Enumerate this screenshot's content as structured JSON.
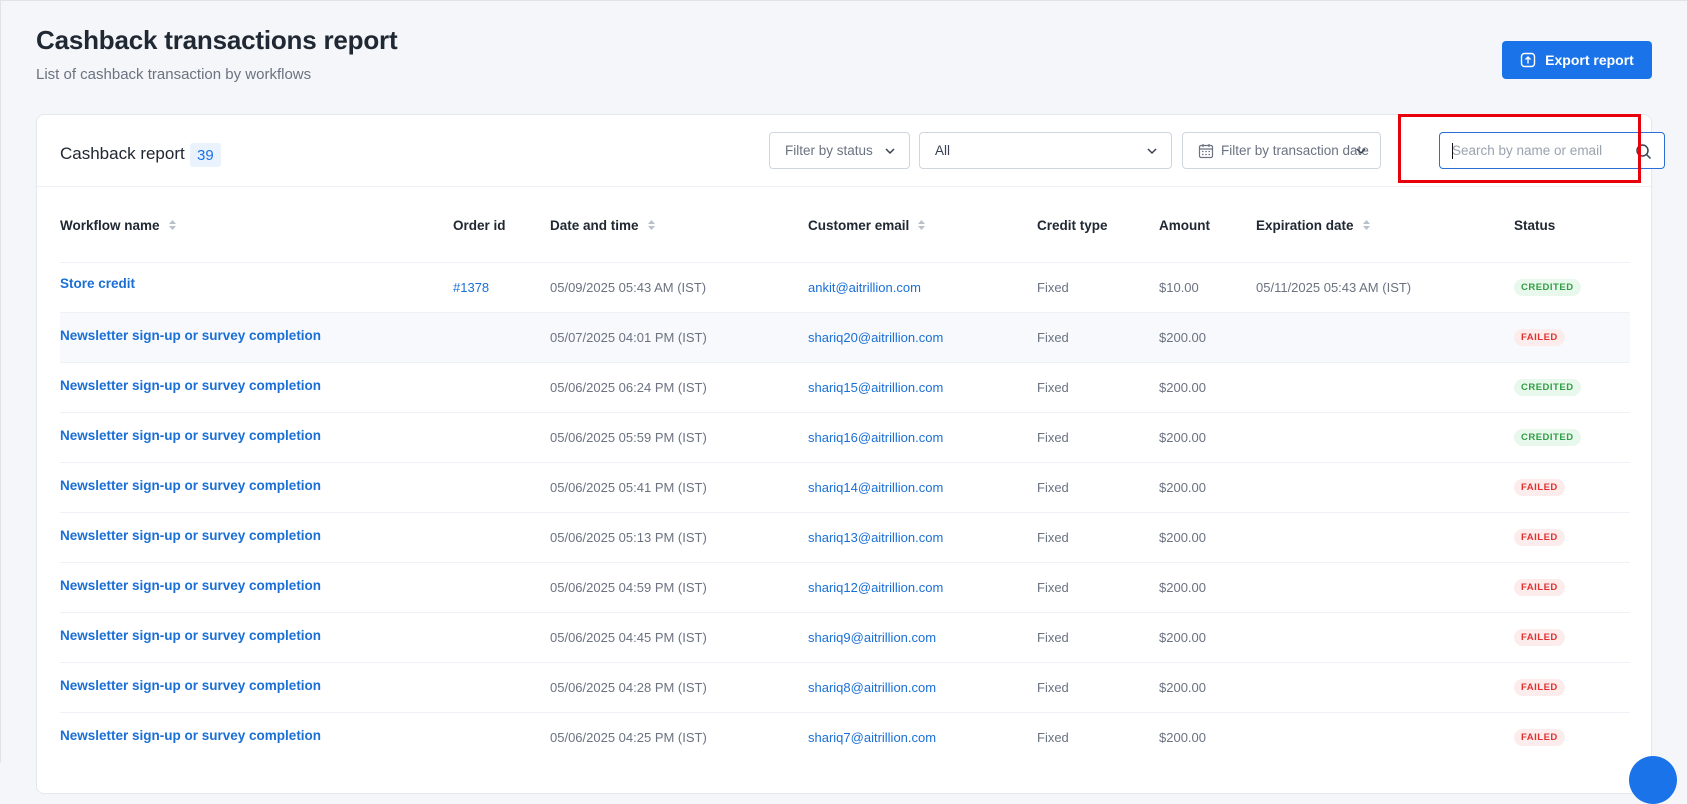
{
  "header": {
    "title": "Cashback transactions report",
    "subtitle": "List of cashback transaction by workflows",
    "export_label": "Export report"
  },
  "card": {
    "title": "Cashback report",
    "count": "39",
    "filters": {
      "status_label": "Filter by status",
      "all_value": "All",
      "date_label": "Filter by transaction date",
      "search_placeholder": "Search by name or email"
    }
  },
  "table": {
    "columns": [
      "Workflow name",
      "Order id",
      "Date and time",
      "Customer email",
      "Credit type",
      "Amount",
      "Expiration date",
      "Status"
    ],
    "rows": [
      {
        "workflow": "Store credit",
        "order": "#1378",
        "datetime": "05/09/2025 05:43 AM (IST)",
        "email": "ankit@aitrillion.com",
        "credit": "Fixed",
        "amount": "$10.00",
        "expiry": "05/11/2025 05:43 AM (IST)",
        "status": "CREDITED"
      },
      {
        "workflow": "Newsletter sign-up or survey completion",
        "order": "",
        "datetime": "05/07/2025 04:01 PM (IST)",
        "email": "shariq20@aitrillion.com",
        "credit": "Fixed",
        "amount": "$200.00",
        "expiry": "",
        "status": "FAILED"
      },
      {
        "workflow": "Newsletter sign-up or survey completion",
        "order": "",
        "datetime": "05/06/2025 06:24 PM (IST)",
        "email": "shariq15@aitrillion.com",
        "credit": "Fixed",
        "amount": "$200.00",
        "expiry": "",
        "status": "CREDITED"
      },
      {
        "workflow": "Newsletter sign-up or survey completion",
        "order": "",
        "datetime": "05/06/2025 05:59 PM (IST)",
        "email": "shariq16@aitrillion.com",
        "credit": "Fixed",
        "amount": "$200.00",
        "expiry": "",
        "status": "CREDITED"
      },
      {
        "workflow": "Newsletter sign-up or survey completion",
        "order": "",
        "datetime": "05/06/2025 05:41 PM (IST)",
        "email": "shariq14@aitrillion.com",
        "credit": "Fixed",
        "amount": "$200.00",
        "expiry": "",
        "status": "FAILED"
      },
      {
        "workflow": "Newsletter sign-up or survey completion",
        "order": "",
        "datetime": "05/06/2025 05:13 PM (IST)",
        "email": "shariq13@aitrillion.com",
        "credit": "Fixed",
        "amount": "$200.00",
        "expiry": "",
        "status": "FAILED"
      },
      {
        "workflow": "Newsletter sign-up or survey completion",
        "order": "",
        "datetime": "05/06/2025 04:59 PM (IST)",
        "email": "shariq12@aitrillion.com",
        "credit": "Fixed",
        "amount": "$200.00",
        "expiry": "",
        "status": "FAILED"
      },
      {
        "workflow": "Newsletter sign-up or survey completion",
        "order": "",
        "datetime": "05/06/2025 04:45 PM (IST)",
        "email": "shariq9@aitrillion.com",
        "credit": "Fixed",
        "amount": "$200.00",
        "expiry": "",
        "status": "FAILED"
      },
      {
        "workflow": "Newsletter sign-up or survey completion",
        "order": "",
        "datetime": "05/06/2025 04:28 PM (IST)",
        "email": "shariq8@aitrillion.com",
        "credit": "Fixed",
        "amount": "$200.00",
        "expiry": "",
        "status": "FAILED"
      },
      {
        "workflow": "Newsletter sign-up or survey completion",
        "order": "",
        "datetime": "05/06/2025 04:25 PM (IST)",
        "email": "shariq7@aitrillion.com",
        "credit": "Fixed",
        "amount": "$200.00",
        "expiry": "",
        "status": "FAILED"
      }
    ]
  },
  "colors": {
    "accent": "#1a73e8",
    "highlight": "#e8000b",
    "credited": "#2f9e44",
    "failed": "#e03131"
  },
  "icons": {
    "export": "upload-icon",
    "chevron": "chevron-down-icon",
    "calendar": "calendar-icon",
    "search": "search-icon",
    "sort": "sort-icon"
  }
}
